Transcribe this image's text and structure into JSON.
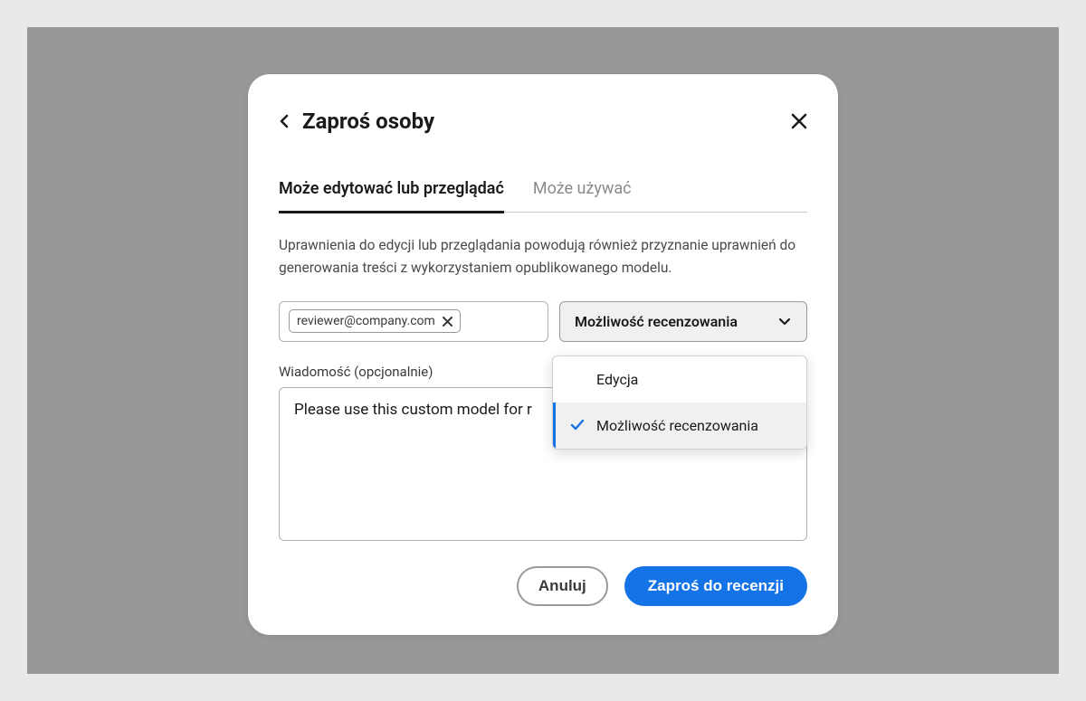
{
  "header": {
    "title": "Zaproś osoby"
  },
  "tabs": {
    "edit_view": "Może edytować lub przeglądać",
    "use": "Może używać"
  },
  "description": "Uprawnienia do edycji lub przeglądania powodują również przyznanie uprawnień do generowania treści z wykorzystaniem opublikowanego modelu.",
  "email": {
    "chip_value": "reviewer@company.com"
  },
  "permission": {
    "selected": "Możliwość recenzowania",
    "options": {
      "edit": "Edycja",
      "review": "Możliwość recenzowania"
    }
  },
  "message": {
    "label": "Wiadomość (opcjonalnie)",
    "value": "Please use this custom model for r"
  },
  "footer": {
    "cancel": "Anuluj",
    "invite": "Zaproś do recenzji"
  }
}
